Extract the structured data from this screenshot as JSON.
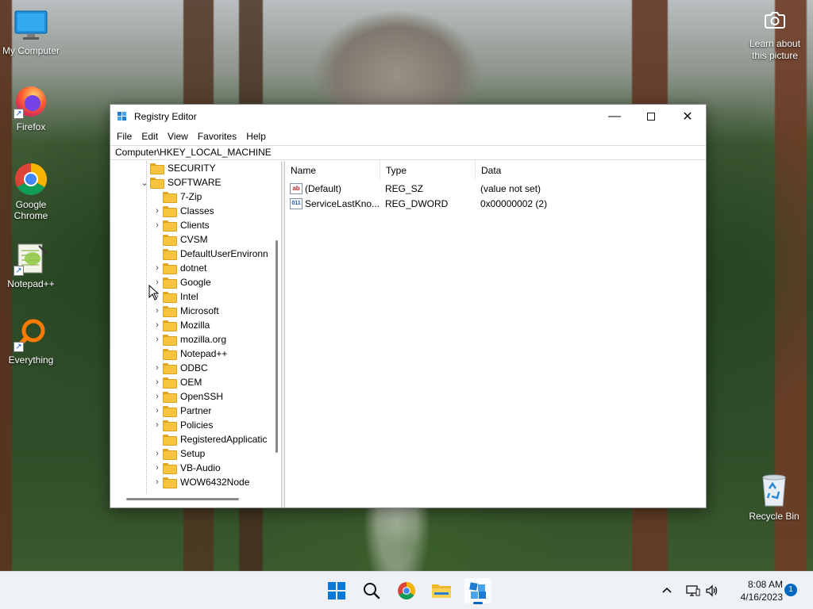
{
  "desktop": {
    "icons": [
      {
        "label": "My Computer",
        "icon": "monitor-icon"
      },
      {
        "label": "Firefox",
        "icon": "firefox-icon"
      },
      {
        "label": "Google Chrome",
        "icon": "chrome-icon"
      },
      {
        "label": "Notepad++",
        "icon": "notepadpp-icon"
      },
      {
        "label": "Everything",
        "icon": "search-magnifier-icon"
      }
    ],
    "learn_line1": "Learn about",
    "learn_line2": "this picture",
    "recycle_bin": "Recycle Bin"
  },
  "window": {
    "title": "Registry Editor",
    "menu": [
      "File",
      "Edit",
      "View",
      "Favorites",
      "Help"
    ],
    "address": "Computer\\HKEY_LOCAL_MACHINE",
    "tree": [
      {
        "label": "SECURITY",
        "level": 0,
        "chevron": ""
      },
      {
        "label": "SOFTWARE",
        "level": 0,
        "chevron": "expanded"
      },
      {
        "label": "7-Zip",
        "level": 1,
        "chevron": ""
      },
      {
        "label": "Classes",
        "level": 1,
        "chevron": "collapsed"
      },
      {
        "label": "Clients",
        "level": 1,
        "chevron": "collapsed"
      },
      {
        "label": "CVSM",
        "level": 1,
        "chevron": ""
      },
      {
        "label": "DefaultUserEnvironn",
        "level": 1,
        "chevron": ""
      },
      {
        "label": "dotnet",
        "level": 1,
        "chevron": "collapsed"
      },
      {
        "label": "Google",
        "level": 1,
        "chevron": "collapsed"
      },
      {
        "label": "Intel",
        "level": 1,
        "chevron": "collapsed"
      },
      {
        "label": "Microsoft",
        "level": 1,
        "chevron": "collapsed"
      },
      {
        "label": "Mozilla",
        "level": 1,
        "chevron": "collapsed"
      },
      {
        "label": "mozilla.org",
        "level": 1,
        "chevron": "collapsed"
      },
      {
        "label": "Notepad++",
        "level": 1,
        "chevron": ""
      },
      {
        "label": "ODBC",
        "level": 1,
        "chevron": "collapsed"
      },
      {
        "label": "OEM",
        "level": 1,
        "chevron": "collapsed"
      },
      {
        "label": "OpenSSH",
        "level": 1,
        "chevron": "collapsed"
      },
      {
        "label": "Partner",
        "level": 1,
        "chevron": "collapsed"
      },
      {
        "label": "Policies",
        "level": 1,
        "chevron": "collapsed"
      },
      {
        "label": "RegisteredApplicatic",
        "level": 1,
        "chevron": ""
      },
      {
        "label": "Setup",
        "level": 1,
        "chevron": "collapsed"
      },
      {
        "label": "VB-Audio",
        "level": 1,
        "chevron": "collapsed"
      },
      {
        "label": "WOW6432Node",
        "level": 1,
        "chevron": "collapsed"
      }
    ],
    "columns": {
      "name": "Name",
      "type": "Type",
      "data": "Data"
    },
    "values": [
      {
        "name": "(Default)",
        "type": "REG_SZ",
        "data": "(value not set)",
        "icon": "string-value-icon"
      },
      {
        "name": "ServiceLastKno...",
        "type": "REG_DWORD",
        "data": "0x00000002 (2)",
        "icon": "binary-value-icon"
      }
    ]
  },
  "taskbar": {
    "apps": [
      "windows-start-icon",
      "search-icon",
      "chrome-icon",
      "file-explorer-icon",
      "registry-editor-icon"
    ],
    "time": "8:08 AM",
    "date": "4/16/2023",
    "notifications": "1"
  },
  "colors": {
    "accent": "#0067c0",
    "folder": "#f6c43e",
    "taskbar": "#eef1f5"
  }
}
